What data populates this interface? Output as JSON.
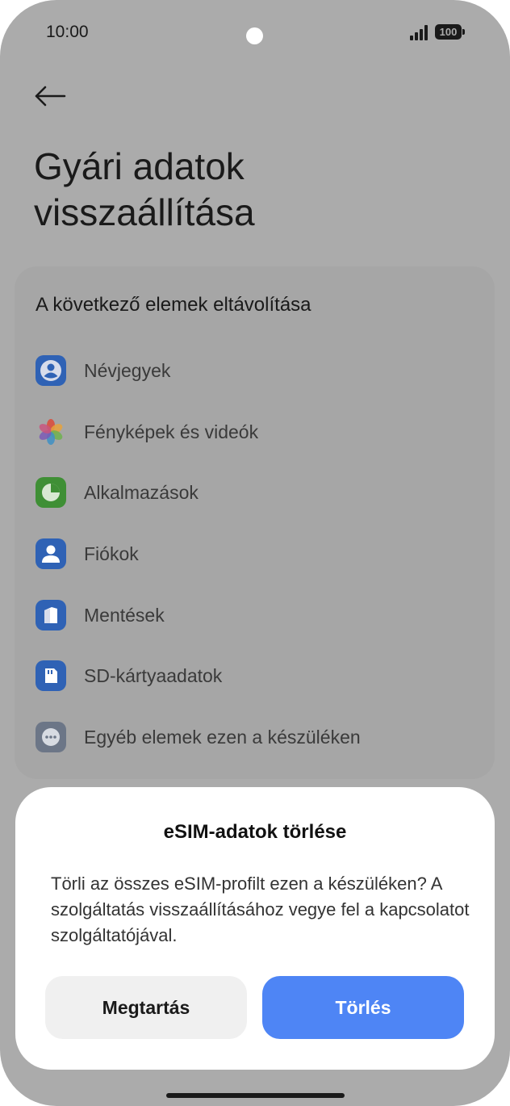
{
  "status": {
    "time": "10:00",
    "battery": "100"
  },
  "header": {
    "title_line1": "Gyári adatok",
    "title_line2": "visszaállítása"
  },
  "card": {
    "heading": "A következő elemek eltávolítása",
    "items": [
      {
        "label": "Névjegyek",
        "icon": "contacts-icon"
      },
      {
        "label": "Fényképek és videók",
        "icon": "photos-icon"
      },
      {
        "label": "Alkalmazások",
        "icon": "apps-icon"
      },
      {
        "label": "Fiókok",
        "icon": "accounts-icon"
      },
      {
        "label": "Mentések",
        "icon": "backups-icon"
      },
      {
        "label": "SD-kártyaadatok",
        "icon": "sd-card-icon"
      },
      {
        "label": "Egyéb elemek ezen a készüléken",
        "icon": "more-icon"
      }
    ]
  },
  "dialog": {
    "title": "eSIM-adatok törlése",
    "message": "Törli az összes eSIM-profilt ezen a készüléken? A szolgáltatás visszaállításához vegye fel a kapcsolatot szolgáltatójával.",
    "keep_label": "Megtartás",
    "delete_label": "Törlés"
  },
  "colors": {
    "accent": "#4e85f5",
    "dim_background": "#ababab"
  }
}
